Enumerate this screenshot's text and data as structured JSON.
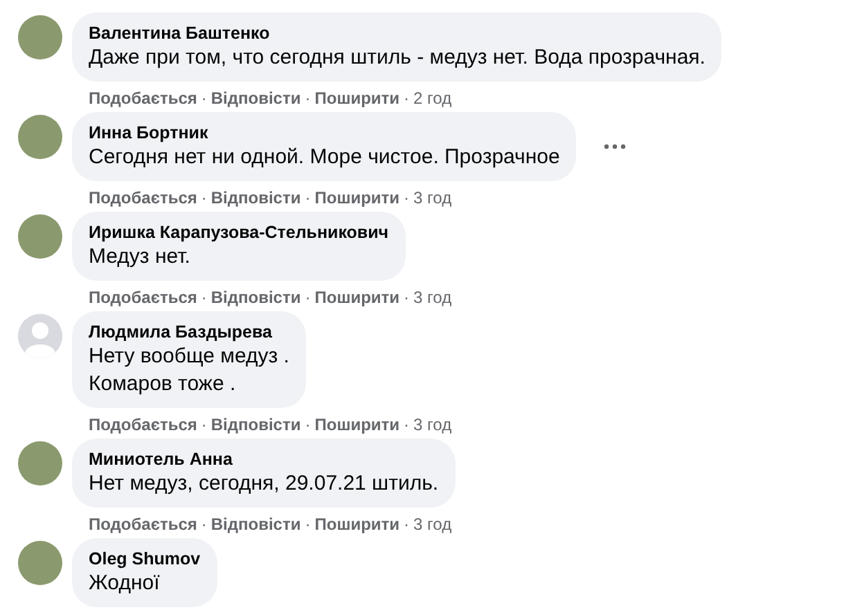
{
  "comments": [
    {
      "author": "Валентина Баштенко",
      "avatar": {
        "kind": "photo"
      },
      "lines": [
        "Даже при том, что сегодня штиль - медуз нет. Вода прозрачная."
      ],
      "menu_visible": false,
      "actions": [
        {
          "kind": "link",
          "text": "Подобається"
        },
        {
          "kind": "sep",
          "text": "·"
        },
        {
          "kind": "link",
          "text": "Відповісти"
        },
        {
          "kind": "sep",
          "text": "·"
        },
        {
          "kind": "link",
          "text": "Поширити"
        },
        {
          "kind": "sep",
          "text": "·"
        },
        {
          "kind": "time",
          "text": "2 год"
        }
      ]
    },
    {
      "author": "Инна Бортник",
      "avatar": {
        "kind": "photo"
      },
      "lines": [
        "Сегодня нет ни одной. Море чистое. Прозрачное"
      ],
      "menu_visible": true,
      "actions": [
        {
          "kind": "link",
          "text": "Подобається"
        },
        {
          "kind": "sep",
          "text": "·"
        },
        {
          "kind": "link",
          "text": "Відповісти"
        },
        {
          "kind": "sep",
          "text": "·"
        },
        {
          "kind": "link",
          "text": "Поширити"
        },
        {
          "kind": "sep",
          "text": "·"
        },
        {
          "kind": "time",
          "text": "3 год"
        }
      ]
    },
    {
      "author": "Иришка Карапузова-Стельникович",
      "avatar": {
        "kind": "photo"
      },
      "lines": [
        "Медуз нет."
      ],
      "menu_visible": false,
      "actions": [
        {
          "kind": "link",
          "text": "Подобається"
        },
        {
          "kind": "sep",
          "text": "·"
        },
        {
          "kind": "link",
          "text": "Відповісти"
        },
        {
          "kind": "sep",
          "text": "·"
        },
        {
          "kind": "link",
          "text": "Поширити"
        },
        {
          "kind": "sep",
          "text": "·"
        },
        {
          "kind": "time",
          "text": "3 год"
        }
      ]
    },
    {
      "author": "Людмила Баздырева",
      "avatar": {
        "kind": "default"
      },
      "lines": [
        "Нету вообще медуз .",
        "Комаров тоже ."
      ],
      "menu_visible": false,
      "actions": [
        {
          "kind": "link",
          "text": "Подобається"
        },
        {
          "kind": "sep",
          "text": "·"
        },
        {
          "kind": "link",
          "text": "Відповісти"
        },
        {
          "kind": "sep",
          "text": "·"
        },
        {
          "kind": "link",
          "text": "Поширити"
        },
        {
          "kind": "sep",
          "text": "·"
        },
        {
          "kind": "time",
          "text": "3 год"
        }
      ]
    },
    {
      "author": "Миниотель Анна",
      "avatar": {
        "kind": "photo"
      },
      "lines": [
        "Нет медуз, сегодня, 29.07.21 штиль."
      ],
      "menu_visible": false,
      "actions": [
        {
          "kind": "link",
          "text": "Подобається"
        },
        {
          "kind": "sep",
          "text": "·"
        },
        {
          "kind": "link",
          "text": "Відповісти"
        },
        {
          "kind": "sep",
          "text": "·"
        },
        {
          "kind": "link",
          "text": "Поширити"
        },
        {
          "kind": "sep",
          "text": "·"
        },
        {
          "kind": "time",
          "text": "3 год"
        }
      ]
    },
    {
      "author": "Oleg Shumov",
      "avatar": {
        "kind": "photo"
      },
      "lines": [
        "Жодної"
      ],
      "menu_visible": false
    }
  ]
}
